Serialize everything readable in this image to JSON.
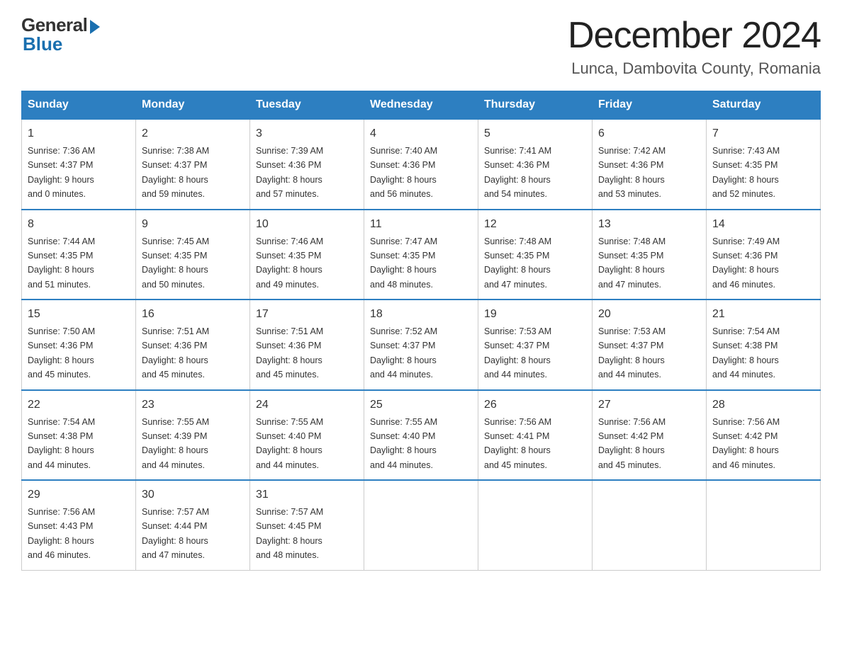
{
  "header": {
    "logo_general": "General",
    "logo_blue": "Blue",
    "title": "December 2024",
    "subtitle": "Lunca, Dambovita County, Romania"
  },
  "days_of_week": [
    "Sunday",
    "Monday",
    "Tuesday",
    "Wednesday",
    "Thursday",
    "Friday",
    "Saturday"
  ],
  "weeks": [
    [
      {
        "day": "1",
        "sunrise": "7:36 AM",
        "sunset": "4:37 PM",
        "daylight": "9 hours and 0 minutes."
      },
      {
        "day": "2",
        "sunrise": "7:38 AM",
        "sunset": "4:37 PM",
        "daylight": "8 hours and 59 minutes."
      },
      {
        "day": "3",
        "sunrise": "7:39 AM",
        "sunset": "4:36 PM",
        "daylight": "8 hours and 57 minutes."
      },
      {
        "day": "4",
        "sunrise": "7:40 AM",
        "sunset": "4:36 PM",
        "daylight": "8 hours and 56 minutes."
      },
      {
        "day": "5",
        "sunrise": "7:41 AM",
        "sunset": "4:36 PM",
        "daylight": "8 hours and 54 minutes."
      },
      {
        "day": "6",
        "sunrise": "7:42 AM",
        "sunset": "4:36 PM",
        "daylight": "8 hours and 53 minutes."
      },
      {
        "day": "7",
        "sunrise": "7:43 AM",
        "sunset": "4:35 PM",
        "daylight": "8 hours and 52 minutes."
      }
    ],
    [
      {
        "day": "8",
        "sunrise": "7:44 AM",
        "sunset": "4:35 PM",
        "daylight": "8 hours and 51 minutes."
      },
      {
        "day": "9",
        "sunrise": "7:45 AM",
        "sunset": "4:35 PM",
        "daylight": "8 hours and 50 minutes."
      },
      {
        "day": "10",
        "sunrise": "7:46 AM",
        "sunset": "4:35 PM",
        "daylight": "8 hours and 49 minutes."
      },
      {
        "day": "11",
        "sunrise": "7:47 AM",
        "sunset": "4:35 PM",
        "daylight": "8 hours and 48 minutes."
      },
      {
        "day": "12",
        "sunrise": "7:48 AM",
        "sunset": "4:35 PM",
        "daylight": "8 hours and 47 minutes."
      },
      {
        "day": "13",
        "sunrise": "7:48 AM",
        "sunset": "4:35 PM",
        "daylight": "8 hours and 47 minutes."
      },
      {
        "day": "14",
        "sunrise": "7:49 AM",
        "sunset": "4:36 PM",
        "daylight": "8 hours and 46 minutes."
      }
    ],
    [
      {
        "day": "15",
        "sunrise": "7:50 AM",
        "sunset": "4:36 PM",
        "daylight": "8 hours and 45 minutes."
      },
      {
        "day": "16",
        "sunrise": "7:51 AM",
        "sunset": "4:36 PM",
        "daylight": "8 hours and 45 minutes."
      },
      {
        "day": "17",
        "sunrise": "7:51 AM",
        "sunset": "4:36 PM",
        "daylight": "8 hours and 45 minutes."
      },
      {
        "day": "18",
        "sunrise": "7:52 AM",
        "sunset": "4:37 PM",
        "daylight": "8 hours and 44 minutes."
      },
      {
        "day": "19",
        "sunrise": "7:53 AM",
        "sunset": "4:37 PM",
        "daylight": "8 hours and 44 minutes."
      },
      {
        "day": "20",
        "sunrise": "7:53 AM",
        "sunset": "4:37 PM",
        "daylight": "8 hours and 44 minutes."
      },
      {
        "day": "21",
        "sunrise": "7:54 AM",
        "sunset": "4:38 PM",
        "daylight": "8 hours and 44 minutes."
      }
    ],
    [
      {
        "day": "22",
        "sunrise": "7:54 AM",
        "sunset": "4:38 PM",
        "daylight": "8 hours and 44 minutes."
      },
      {
        "day": "23",
        "sunrise": "7:55 AM",
        "sunset": "4:39 PM",
        "daylight": "8 hours and 44 minutes."
      },
      {
        "day": "24",
        "sunrise": "7:55 AM",
        "sunset": "4:40 PM",
        "daylight": "8 hours and 44 minutes."
      },
      {
        "day": "25",
        "sunrise": "7:55 AM",
        "sunset": "4:40 PM",
        "daylight": "8 hours and 44 minutes."
      },
      {
        "day": "26",
        "sunrise": "7:56 AM",
        "sunset": "4:41 PM",
        "daylight": "8 hours and 45 minutes."
      },
      {
        "day": "27",
        "sunrise": "7:56 AM",
        "sunset": "4:42 PM",
        "daylight": "8 hours and 45 minutes."
      },
      {
        "day": "28",
        "sunrise": "7:56 AM",
        "sunset": "4:42 PM",
        "daylight": "8 hours and 46 minutes."
      }
    ],
    [
      {
        "day": "29",
        "sunrise": "7:56 AM",
        "sunset": "4:43 PM",
        "daylight": "8 hours and 46 minutes."
      },
      {
        "day": "30",
        "sunrise": "7:57 AM",
        "sunset": "4:44 PM",
        "daylight": "8 hours and 47 minutes."
      },
      {
        "day": "31",
        "sunrise": "7:57 AM",
        "sunset": "4:45 PM",
        "daylight": "8 hours and 48 minutes."
      },
      null,
      null,
      null,
      null
    ]
  ],
  "labels": {
    "sunrise": "Sunrise:",
    "sunset": "Sunset:",
    "daylight": "Daylight:"
  }
}
